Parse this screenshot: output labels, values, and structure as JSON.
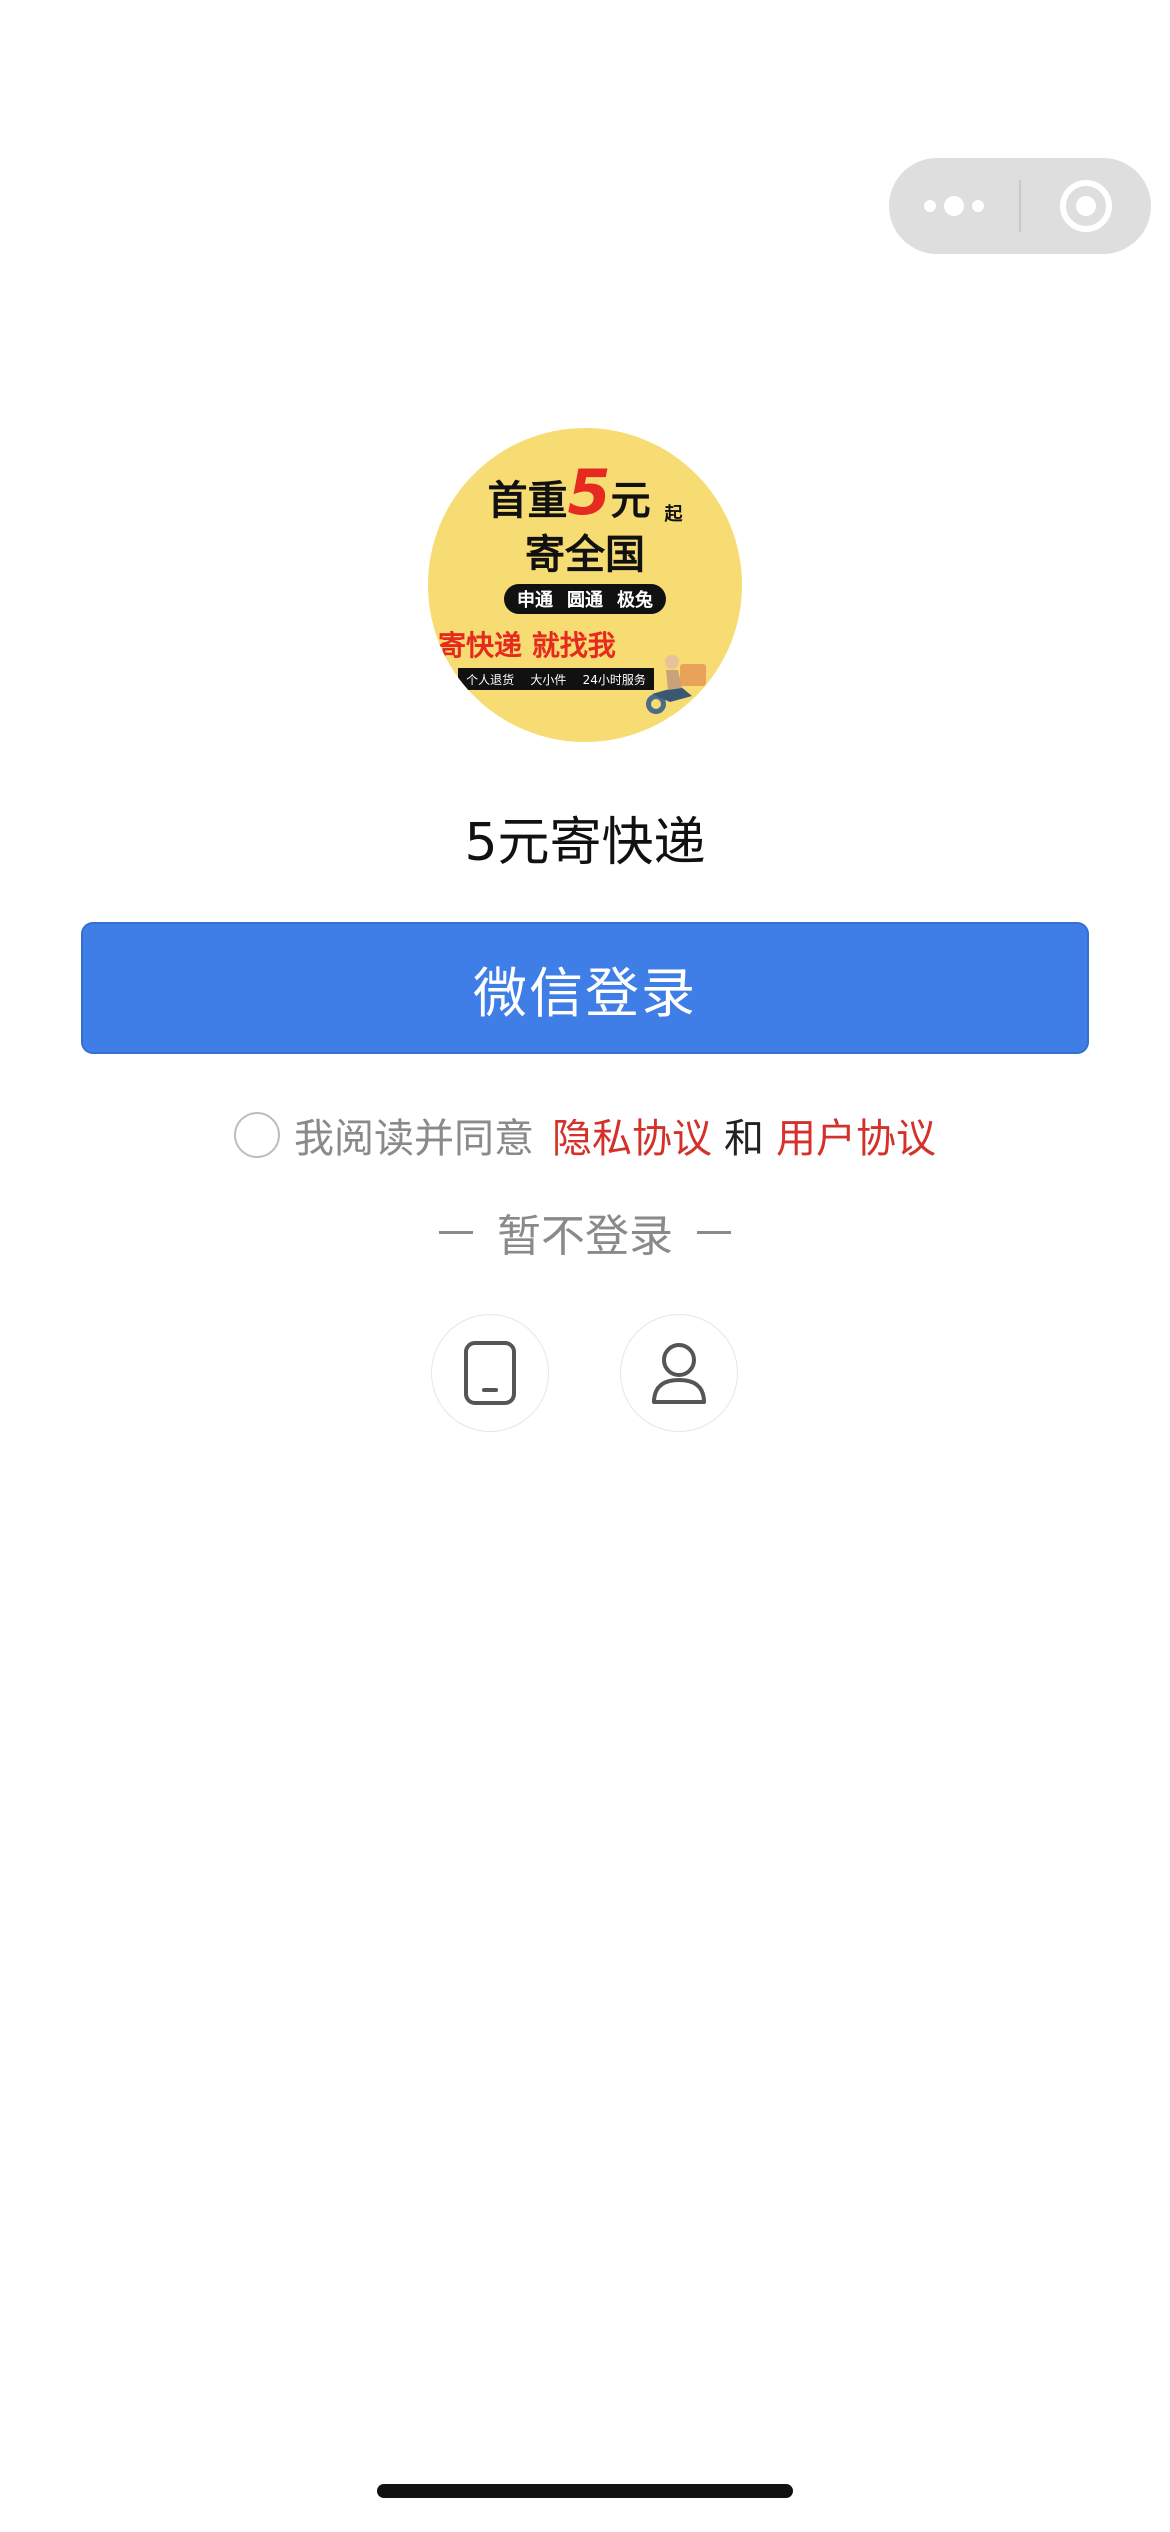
{
  "capsule": {
    "more_icon": "more-dots-icon",
    "close_icon": "target-icon"
  },
  "logo": {
    "line1_prefix": "首重",
    "line1_big": "5",
    "line1_suffix": "元",
    "line1_small": "起",
    "line2": "寄全国",
    "carriers": [
      "申通",
      "圆通",
      "极兔"
    ],
    "slogan": "寄快递 就找我",
    "tags": [
      "个人退货",
      "大小件",
      "24小时服务"
    ]
  },
  "app_name": "5元寄快递",
  "login_button": "微信登录",
  "agreement": {
    "prefix": "我阅读并同意",
    "privacy": "隐私协议",
    "and": "和",
    "user": "用户协议"
  },
  "skip_login": "暂不登录",
  "alt_logins": [
    {
      "icon": "phone-icon"
    },
    {
      "icon": "user-icon"
    }
  ],
  "colors": {
    "primary": "#3f7ee6",
    "link": "#d4312b",
    "logo_bg": "#f6dc72"
  }
}
